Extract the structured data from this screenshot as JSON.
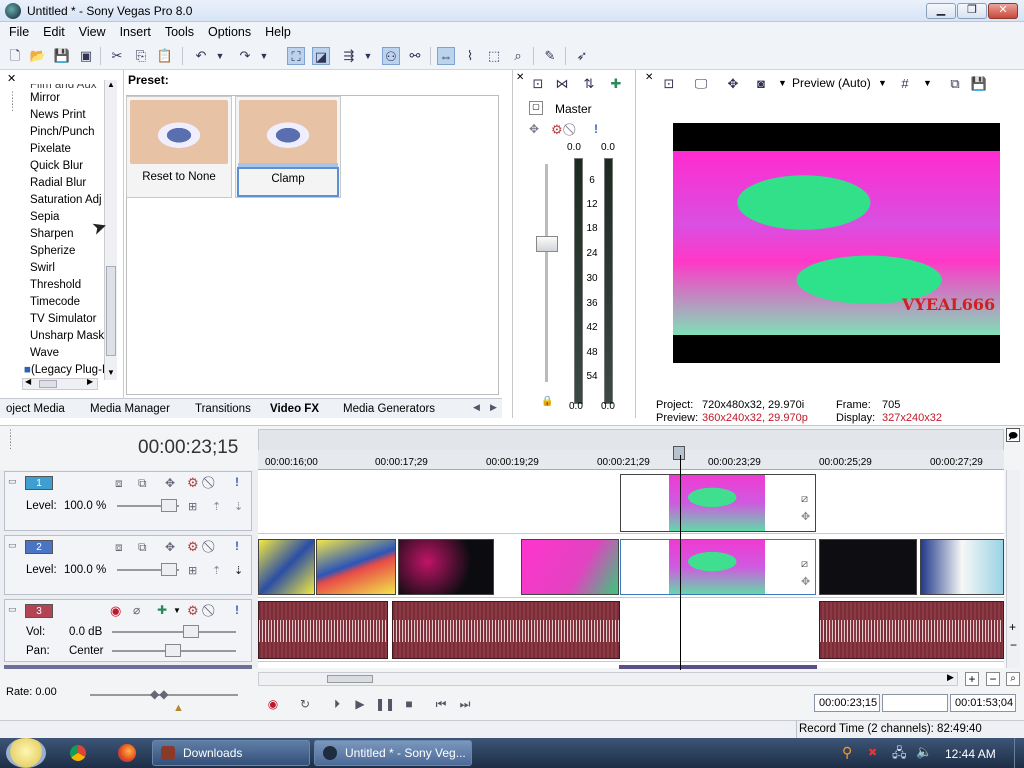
{
  "window": {
    "title": "Untitled * - Sony Vegas Pro 8.0",
    "min": "▁",
    "max": "❐",
    "close": "✕"
  },
  "menu": [
    "File",
    "Edit",
    "View",
    "Insert",
    "Tools",
    "Options",
    "Help"
  ],
  "fx_list": {
    "items": [
      "Mirror",
      "News Print",
      "Pinch/Punch",
      "Pixelate",
      "Quick Blur",
      "Radial Blur",
      "Saturation Adj",
      "Sepia",
      "Sharpen",
      "Spherize",
      "Swirl",
      "Threshold",
      "Timecode",
      "TV Simulator",
      "Unsharp Mask",
      "Wave",
      "(Legacy Plug-I"
    ],
    "partial_top": "Film and Aux"
  },
  "presets": {
    "label": "Preset:",
    "items": [
      "Reset to None",
      "Clamp"
    ]
  },
  "tabs": [
    "oject Media",
    "Media Manager",
    "Transitions",
    "Video FX",
    "Media Generators"
  ],
  "master": {
    "title": "Master",
    "peak_left": "0.0",
    "peak_right": "0.0",
    "scale": [
      "6",
      "12",
      "18",
      "24",
      "30",
      "36",
      "42",
      "48",
      "54"
    ],
    "bottom_left": "0.0",
    "bottom_right": "0.0"
  },
  "preview": {
    "mode": "Preview (Auto)",
    "watermark": "VYEAL666",
    "project_label": "Project:",
    "project_value": "720x480x32, 29.970i",
    "preview_label": "Preview:",
    "preview_value": "360x240x32, 29.970p",
    "frame_label": "Frame:",
    "frame_value": "705",
    "display_label": "Display:",
    "display_value": "327x240x32"
  },
  "timeline": {
    "timecode": "00:00:23;15",
    "ruler": [
      "00:00:16;00",
      "00:00:17;29",
      "00:00:19;29",
      "00:00:21;29",
      "00:00:23;29",
      "00:00:25;29",
      "00:00:27;29"
    ],
    "tracks": [
      {
        "num": "1",
        "level_label": "Level:",
        "level_value": "100.0 %",
        "color": "#3f9fd0"
      },
      {
        "num": "2",
        "level_label": "Level:",
        "level_value": "100.0 %",
        "color": "#4a74c4"
      },
      {
        "num": "3",
        "vol_label": "Vol:",
        "vol_value": "0.0 dB",
        "pan_label": "Pan:",
        "pan_value": "Center",
        "color": "#b24454"
      }
    ],
    "rate_label": "Rate: 0.00"
  },
  "transport": {
    "cursor_time": "00:00:23;15",
    "selection_len": "00:01:53;04"
  },
  "status": {
    "record_time": "Record Time (2 channels): 82:49:40"
  },
  "taskbar": {
    "tasks": [
      "Downloads",
      "Untitled * - Sony Veg..."
    ],
    "clock": "12:44 AM"
  },
  "colors": {
    "accent": "#7ea3cf",
    "record": "#c0182a",
    "audio_clip": "#7b2c36"
  }
}
